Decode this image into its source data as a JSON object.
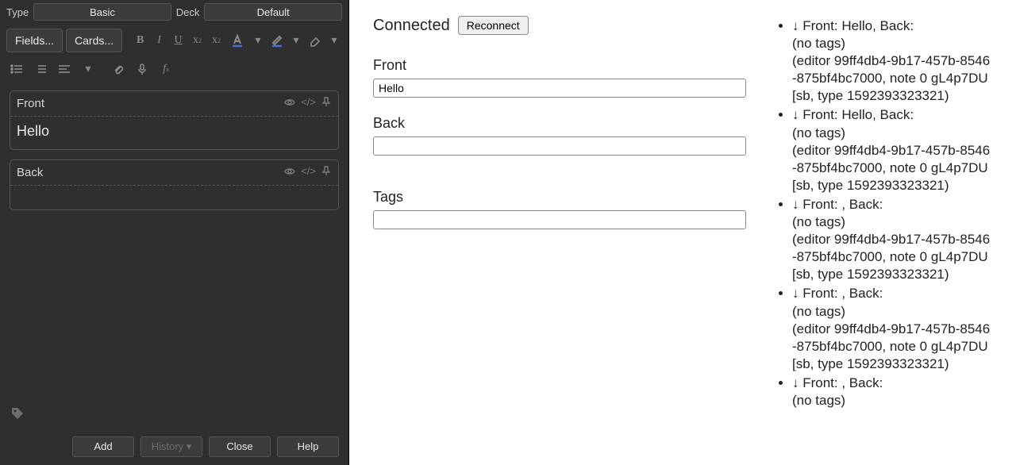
{
  "left": {
    "type_label": "Type",
    "type_value": "Basic",
    "deck_label": "Deck",
    "deck_value": "Default",
    "fields_btn": "Fields...",
    "cards_btn": "Cards...",
    "front_label": "Front",
    "front_value": "Hello",
    "back_label": "Back",
    "back_value": "",
    "add_btn": "Add",
    "history_btn": "History ▾",
    "close_btn": "Close",
    "help_btn": "Help"
  },
  "right": {
    "status": "Connected",
    "reconnect": "Reconnect",
    "front_label": "Front",
    "front_value": "Hello",
    "back_label": "Back",
    "back_value": "",
    "tags_label": "Tags",
    "tags_value": ""
  },
  "log": [
    {
      "line1": "↓ Front: Hello, Back:",
      "line2": "(no tags)",
      "line3": "(editor 99ff4db4-9b17-457b-8546-875bf4bc7000, note 0 gL4p7DU[sb, type 1592393323321)"
    },
    {
      "line1": "↓ Front: Hello, Back:",
      "line2": "(no tags)",
      "line3": "(editor 99ff4db4-9b17-457b-8546-875bf4bc7000, note 0 gL4p7DU[sb, type 1592393323321)"
    },
    {
      "line1": "↓ Front: , Back:",
      "line2": "(no tags)",
      "line3": "(editor 99ff4db4-9b17-457b-8546-875bf4bc7000, note 0 gL4p7DU[sb, type 1592393323321)"
    },
    {
      "line1": "↓ Front: , Back:",
      "line2": "(no tags)",
      "line3": "(editor 99ff4db4-9b17-457b-8546-875bf4bc7000, note 0 gL4p7DU[sb, type 1592393323321)"
    },
    {
      "line1": "↓ Front: , Back:",
      "line2": "(no tags)",
      "line3": ""
    }
  ]
}
